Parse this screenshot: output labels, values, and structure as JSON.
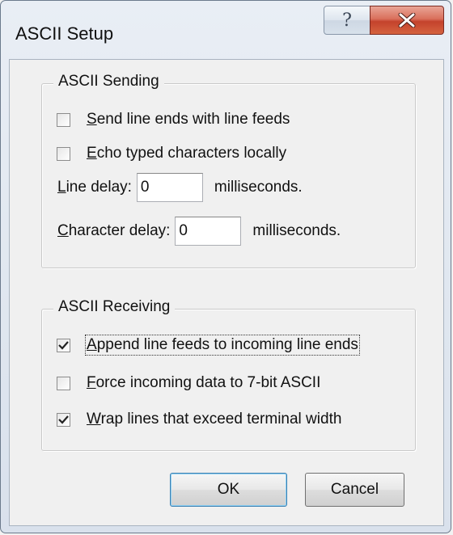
{
  "window": {
    "title": "ASCII Setup",
    "help_symbol": "?"
  },
  "sending": {
    "legend": "ASCII Sending",
    "send_line_ends": {
      "pre": "",
      "mnemonic": "S",
      "post": "end line ends with line feeds",
      "checked": false
    },
    "echo_typed": {
      "pre": "",
      "mnemonic": "E",
      "post": "cho typed characters locally",
      "checked": false
    },
    "line_delay": {
      "pre": "",
      "mnemonic": "L",
      "post": "ine delay:",
      "value": "0",
      "unit": "milliseconds."
    },
    "char_delay": {
      "pre": "",
      "mnemonic": "C",
      "post": "haracter delay:",
      "value": "0",
      "unit": "milliseconds."
    }
  },
  "receiving": {
    "legend": "ASCII Receiving",
    "append_line_feeds": {
      "pre": "",
      "mnemonic": "A",
      "post": "ppend line feeds to incoming line ends",
      "checked": true
    },
    "force_7bit": {
      "pre": "",
      "mnemonic": "F",
      "post": "orce incoming data to 7-bit ASCII",
      "checked": false
    },
    "wrap_lines": {
      "pre": "",
      "mnemonic": "W",
      "post": "rap lines that exceed terminal width",
      "checked": true
    }
  },
  "buttons": {
    "ok": "OK",
    "cancel": "Cancel"
  }
}
